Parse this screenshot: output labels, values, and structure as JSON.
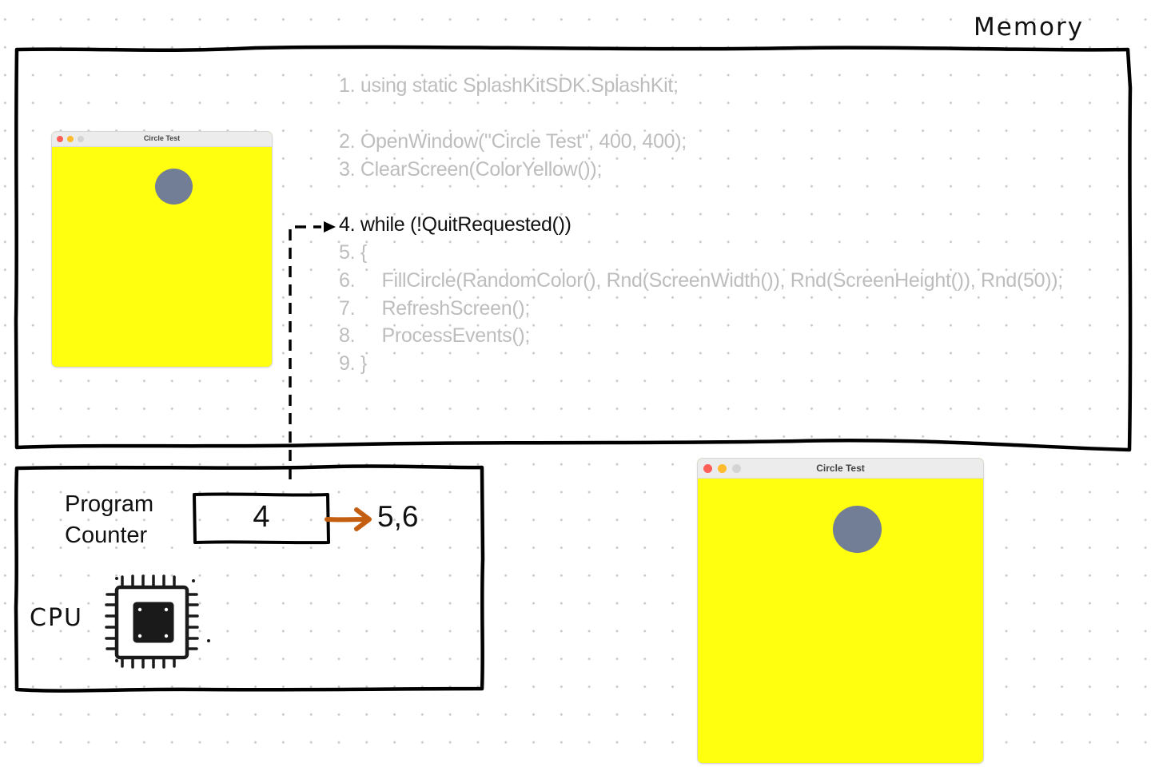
{
  "memory": {
    "label": "Memory",
    "code_lines": [
      {
        "text": "1. using static SplashKitSDK.SplashKit;",
        "active": false
      },
      {
        "text": "2. OpenWindow(\"Circle Test\", 400, 400);",
        "active": false
      },
      {
        "text": "3. ClearScreen(ColorYellow());",
        "active": false
      },
      {
        "text": "4. while (!QuitRequested())",
        "active": true
      },
      {
        "text": "5. {",
        "active": false
      },
      {
        "text": "6.     FillCircle(RandomColor(), Rnd(ScreenWidth()), Rnd(ScreenHeight()), Rnd(50));",
        "active": false
      },
      {
        "text": "7.     RefreshScreen();",
        "active": false
      },
      {
        "text": "8.     ProcessEvents();",
        "active": false
      },
      {
        "text": "9. }",
        "active": false
      }
    ],
    "preview_window": {
      "title": "Circle Test",
      "background_color": "#ffff0f",
      "circle_color": "#717e96"
    }
  },
  "cpu": {
    "label": "CPU",
    "program_counter": {
      "label_line1": "Program",
      "label_line2": "Counter",
      "value": "4",
      "next_value": "5,6",
      "arrow_color": "#c45f12"
    }
  },
  "output_window": {
    "title": "Circle Test",
    "background_color": "#ffff0f",
    "circle_color": "#717e96",
    "traffic_lights": [
      "#fe5f57",
      "#febc2e",
      "#d4d4d4"
    ]
  }
}
